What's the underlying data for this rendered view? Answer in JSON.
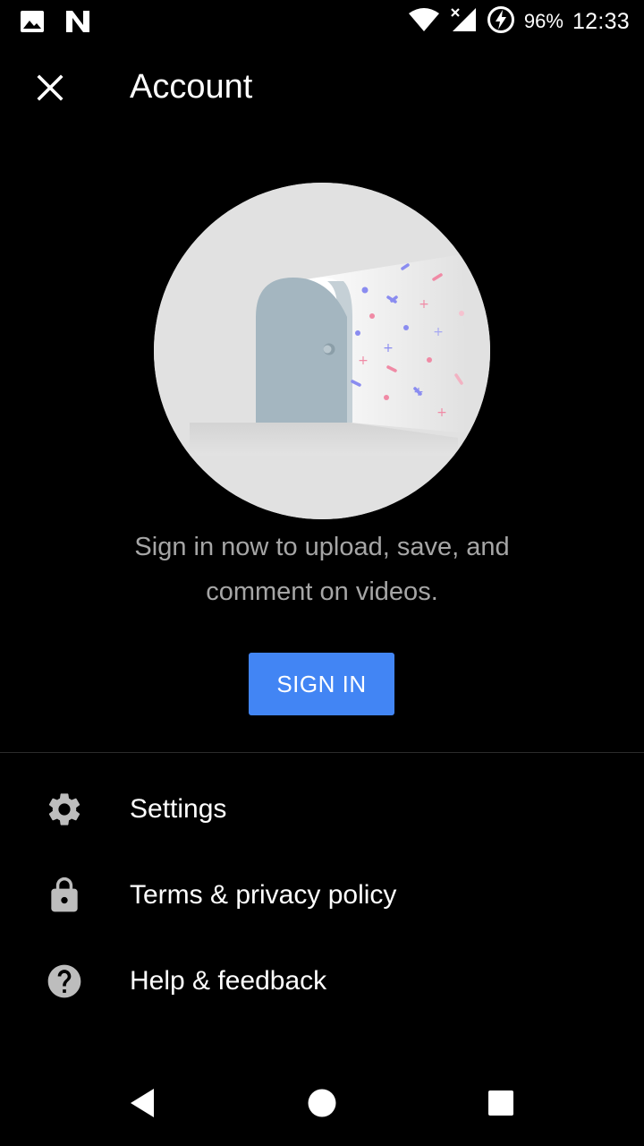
{
  "status_bar": {
    "battery_percent": "96%",
    "time": "12:33",
    "icons": [
      "image-notification-icon",
      "n-notification-icon",
      "wifi-icon",
      "signal-icon",
      "battery-charging-icon"
    ]
  },
  "app_bar": {
    "title": "Account",
    "close_icon": "close-icon"
  },
  "hero": {
    "illustration": "open-door-confetti-illustration"
  },
  "prompt": {
    "text": "Sign in now to upload, save, and\ncomment on videos."
  },
  "sign_in": {
    "label": "SIGN IN",
    "color": "#4285f4"
  },
  "menu": {
    "items": [
      {
        "label": "Settings",
        "icon": "gear-icon"
      },
      {
        "label": "Terms & privacy policy",
        "icon": "lock-icon"
      },
      {
        "label": "Help & feedback",
        "icon": "help-icon"
      }
    ]
  },
  "nav_bar": {
    "buttons": [
      "back-icon",
      "home-icon",
      "recents-icon"
    ]
  }
}
